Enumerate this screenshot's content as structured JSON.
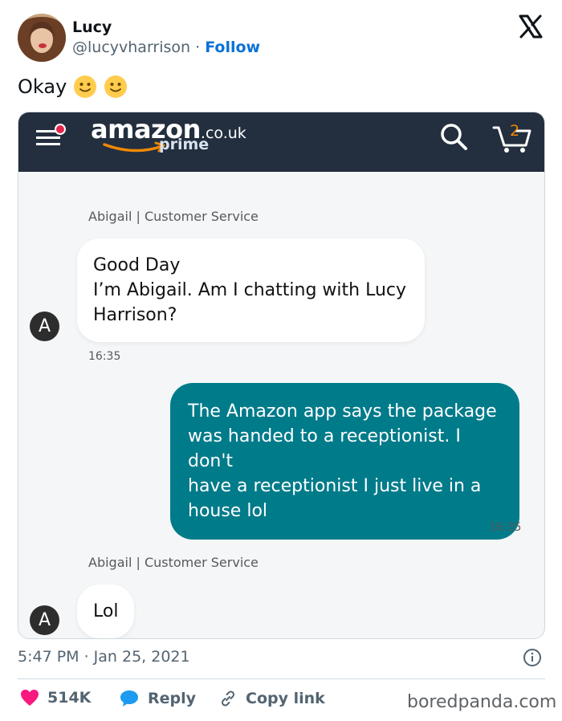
{
  "tweet": {
    "author_name": "Lucy",
    "author_handle": "@lucyvharrison",
    "separator": "·",
    "follow_label": "Follow",
    "text": "Okay",
    "timestamp": "5:47 PM · Jan 25, 2021",
    "likes_count": "514K",
    "reply_label": "Reply",
    "copy_link_label": "Copy link"
  },
  "screenshot": {
    "brand": "amazon",
    "brand_tld": ".co.uk",
    "brand_sub": "prime",
    "cart_count": "2",
    "messages": [
      {
        "sender": "Abigail | Customer Service",
        "lines": [
          "Good Day",
          "I’m Abigail. Am I chatting with Lucy",
          "Harrison?"
        ],
        "time": "16:35",
        "avatar_letter": "A"
      },
      {
        "lines": [
          "The Amazon app says the package",
          "was handed to a receptionist. I don't",
          "have a receptionist I just live in a",
          "house lol"
        ],
        "time": "16:35"
      },
      {
        "sender": "Abigail | Customer Service",
        "lines": [
          "Lol"
        ],
        "avatar_letter": "A"
      }
    ]
  },
  "watermark": "boredpanda.com",
  "colors": {
    "follow": "#0a72d6",
    "amazon_bar": "#232f3e",
    "outgoing_bubble": "#007b8a",
    "like": "#f91880",
    "reply_bubble": "#1d9bf0"
  }
}
